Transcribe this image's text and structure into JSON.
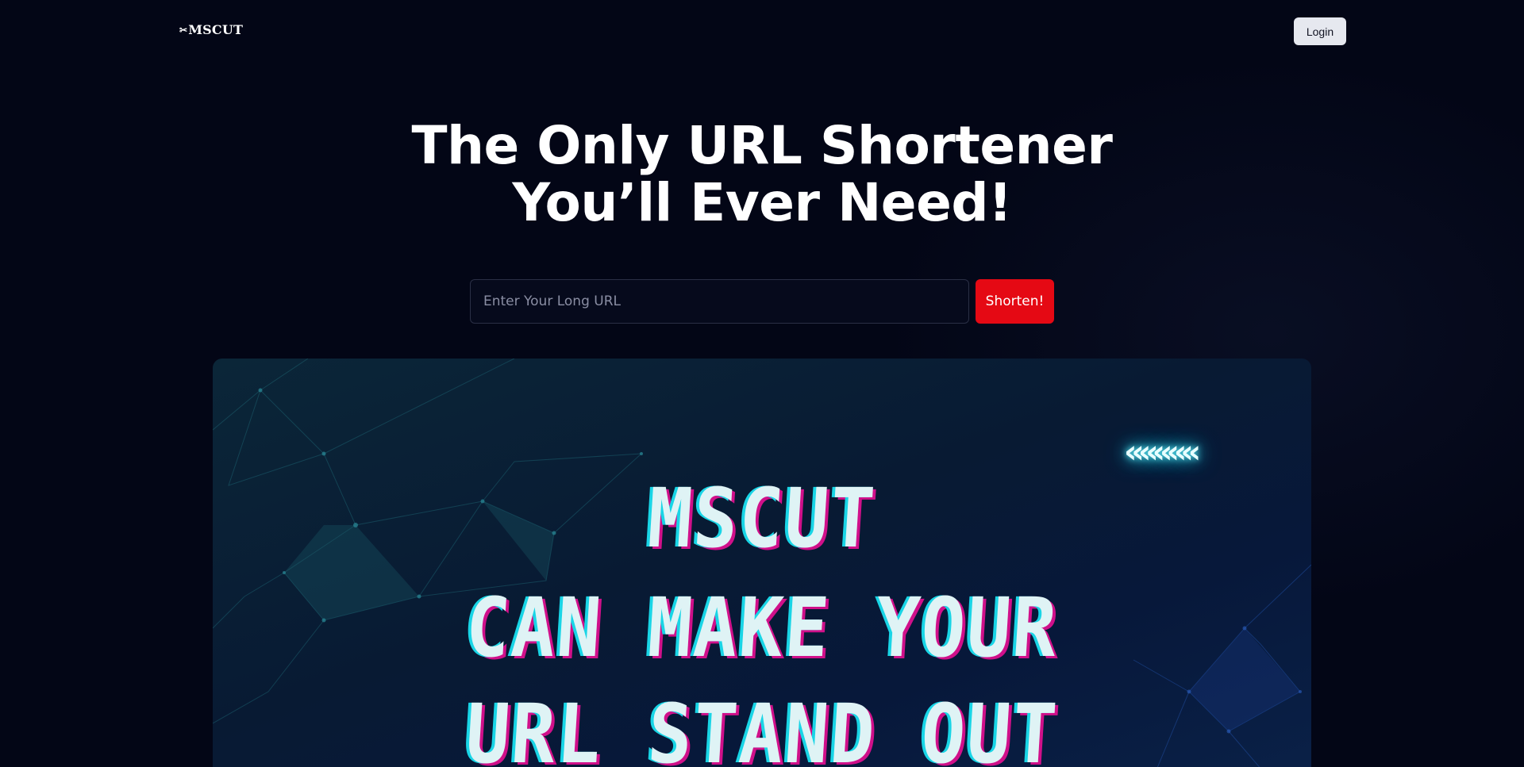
{
  "header": {
    "logo_icon": "scissors-icon",
    "logo_glyph": "✂",
    "logo_text": "MSCUT",
    "login_label": "Login"
  },
  "hero": {
    "title_line1": "The Only URL Shortener",
    "title_line2": "You’ll Ever Need!"
  },
  "shortener": {
    "input_placeholder": "Enter Your Long URL",
    "input_value": "",
    "button_label": "Shorten!"
  },
  "banner": {
    "chevrons_icon": "double-chevron-left-icon",
    "chevrons_glyph": "«««««",
    "line1": "MSCUT",
    "line2": "CAN MAKE YOUR",
    "line3": "URL STAND OUT"
  },
  "colors": {
    "background": "#030616",
    "accent": "#e50914",
    "login_bg": "#e6e8ef",
    "banner_text": "#dff3f5",
    "glitch_cyan": "#19d5e6",
    "glitch_magenta": "#d0108a"
  }
}
